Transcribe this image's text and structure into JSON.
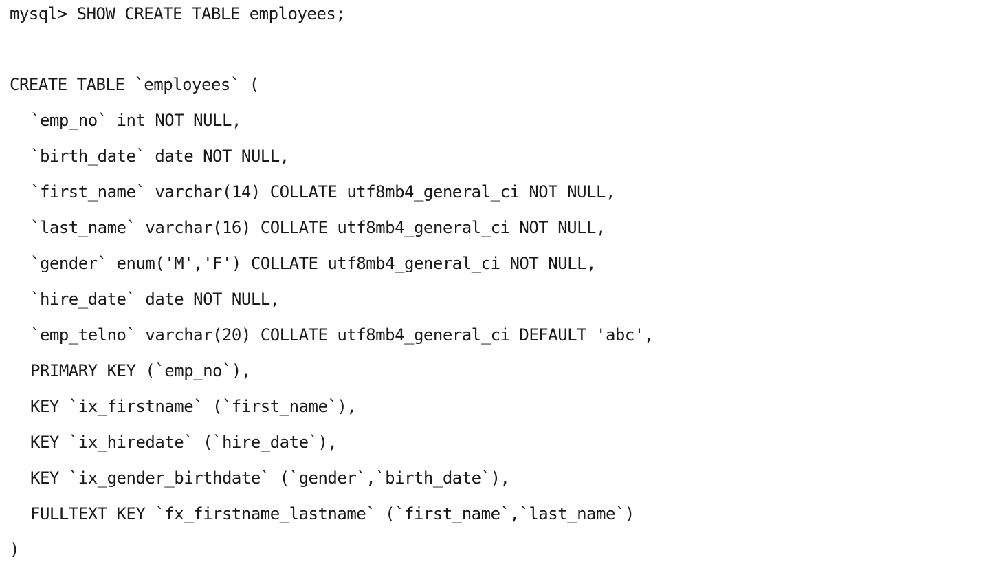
{
  "terminal": {
    "prompt_command": "mysql> SHOW CREATE TABLE employees;",
    "create_statement": {
      "open_line": "CREATE TABLE `employees` (",
      "definitions": [
        "`emp_no` int NOT NULL,",
        "`birth_date` date NOT NULL,",
        "`first_name` varchar(14) COLLATE utf8mb4_general_ci NOT NULL,",
        "`last_name` varchar(16) COLLATE utf8mb4_general_ci NOT NULL,",
        "`gender` enum('M','F') COLLATE utf8mb4_general_ci NOT NULL,",
        "`hire_date` date NOT NULL,",
        "`emp_telno` varchar(20) COLLATE utf8mb4_general_ci DEFAULT 'abc',",
        "PRIMARY KEY (`emp_no`),",
        "KEY `ix_firstname` (`first_name`),",
        "KEY `ix_hiredate` (`hire_date`),",
        "KEY `ix_gender_birthdate` (`gender`,`birth_date`),",
        "FULLTEXT KEY `fx_firstname_lastname` (`first_name`,`last_name`)"
      ],
      "close_line": ")"
    }
  }
}
